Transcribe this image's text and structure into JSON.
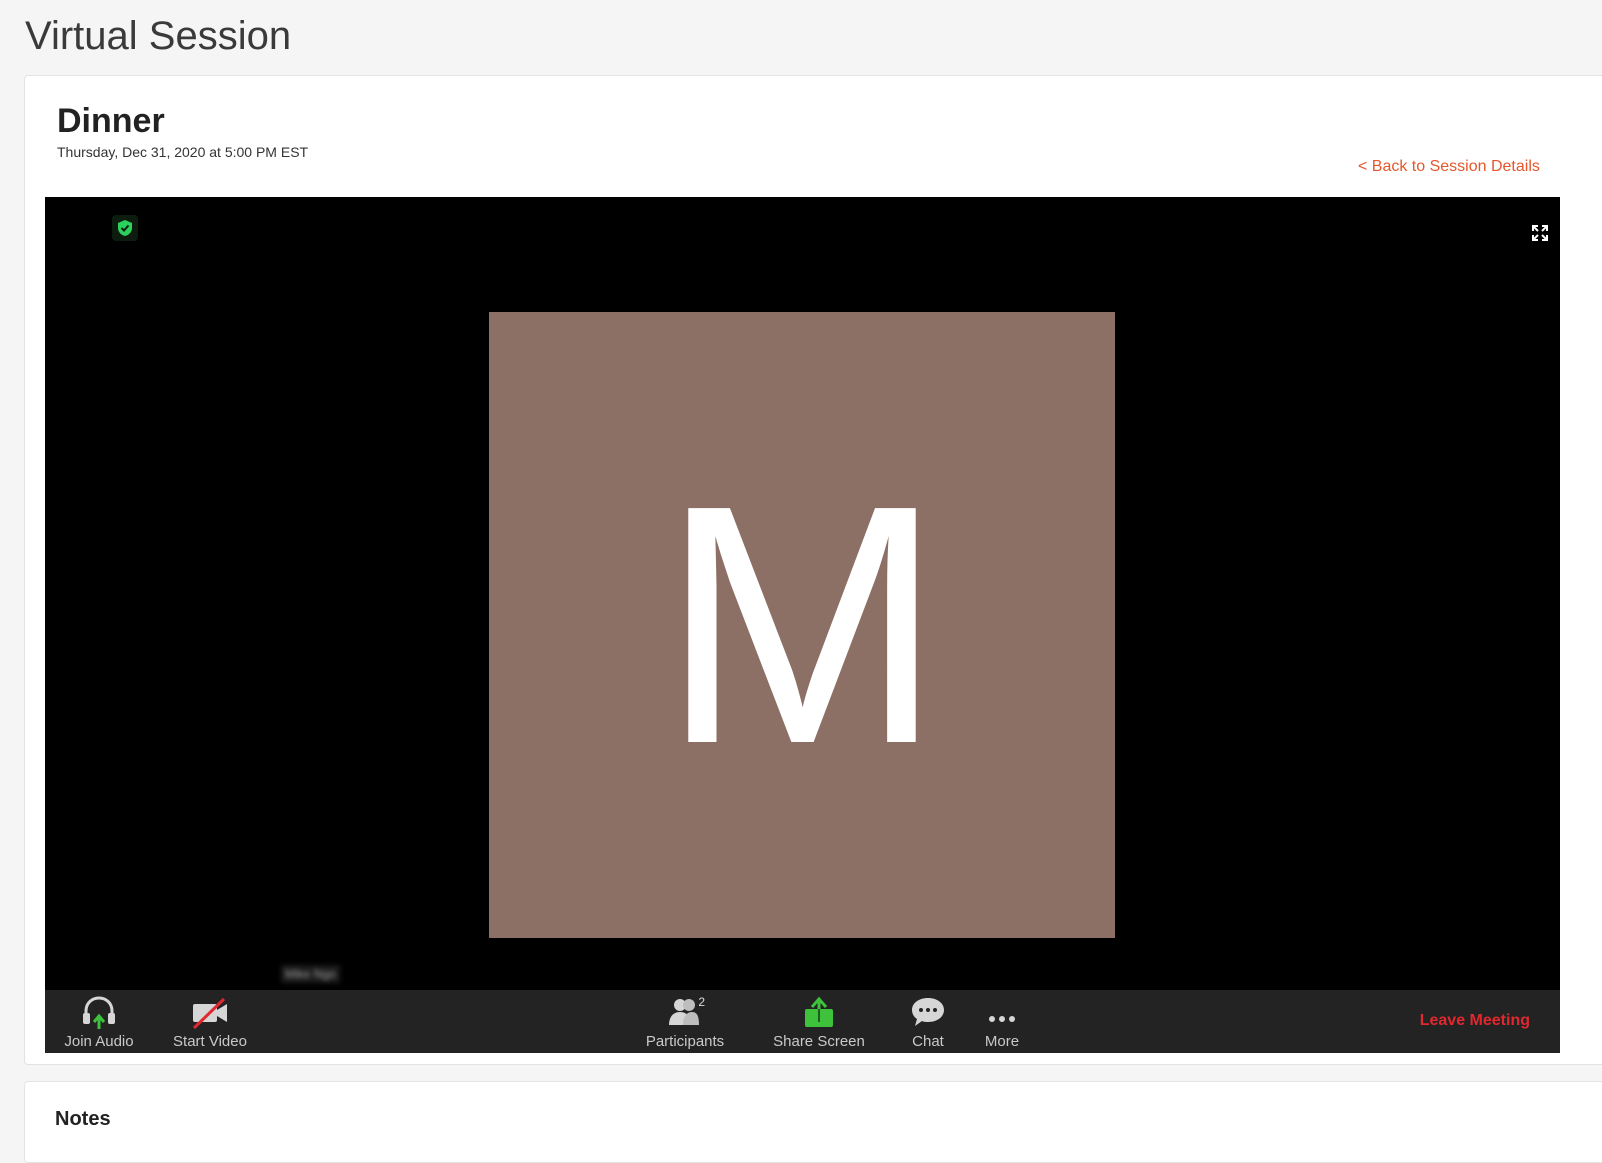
{
  "page": {
    "title": "Virtual Session"
  },
  "session": {
    "name": "Dinner",
    "datetime": "Thursday, Dec 31, 2020 at 5:00 PM EST",
    "back_link": "< Back to Session Details"
  },
  "video": {
    "avatar_letter": "M",
    "avatar_color": "#8d7065",
    "participant_name": "Mike Ngo"
  },
  "toolbar": {
    "join_audio": "Join Audio",
    "start_video": "Start Video",
    "participants": "Participants",
    "participants_count": "2",
    "share_screen": "Share Screen",
    "chat": "Chat",
    "more": "More",
    "leave": "Leave Meeting"
  },
  "colors": {
    "accent_link": "#e4582c",
    "leave_red": "#e0282e",
    "share_green": "#3ec23b"
  },
  "next_section": {
    "title": "Notes"
  }
}
